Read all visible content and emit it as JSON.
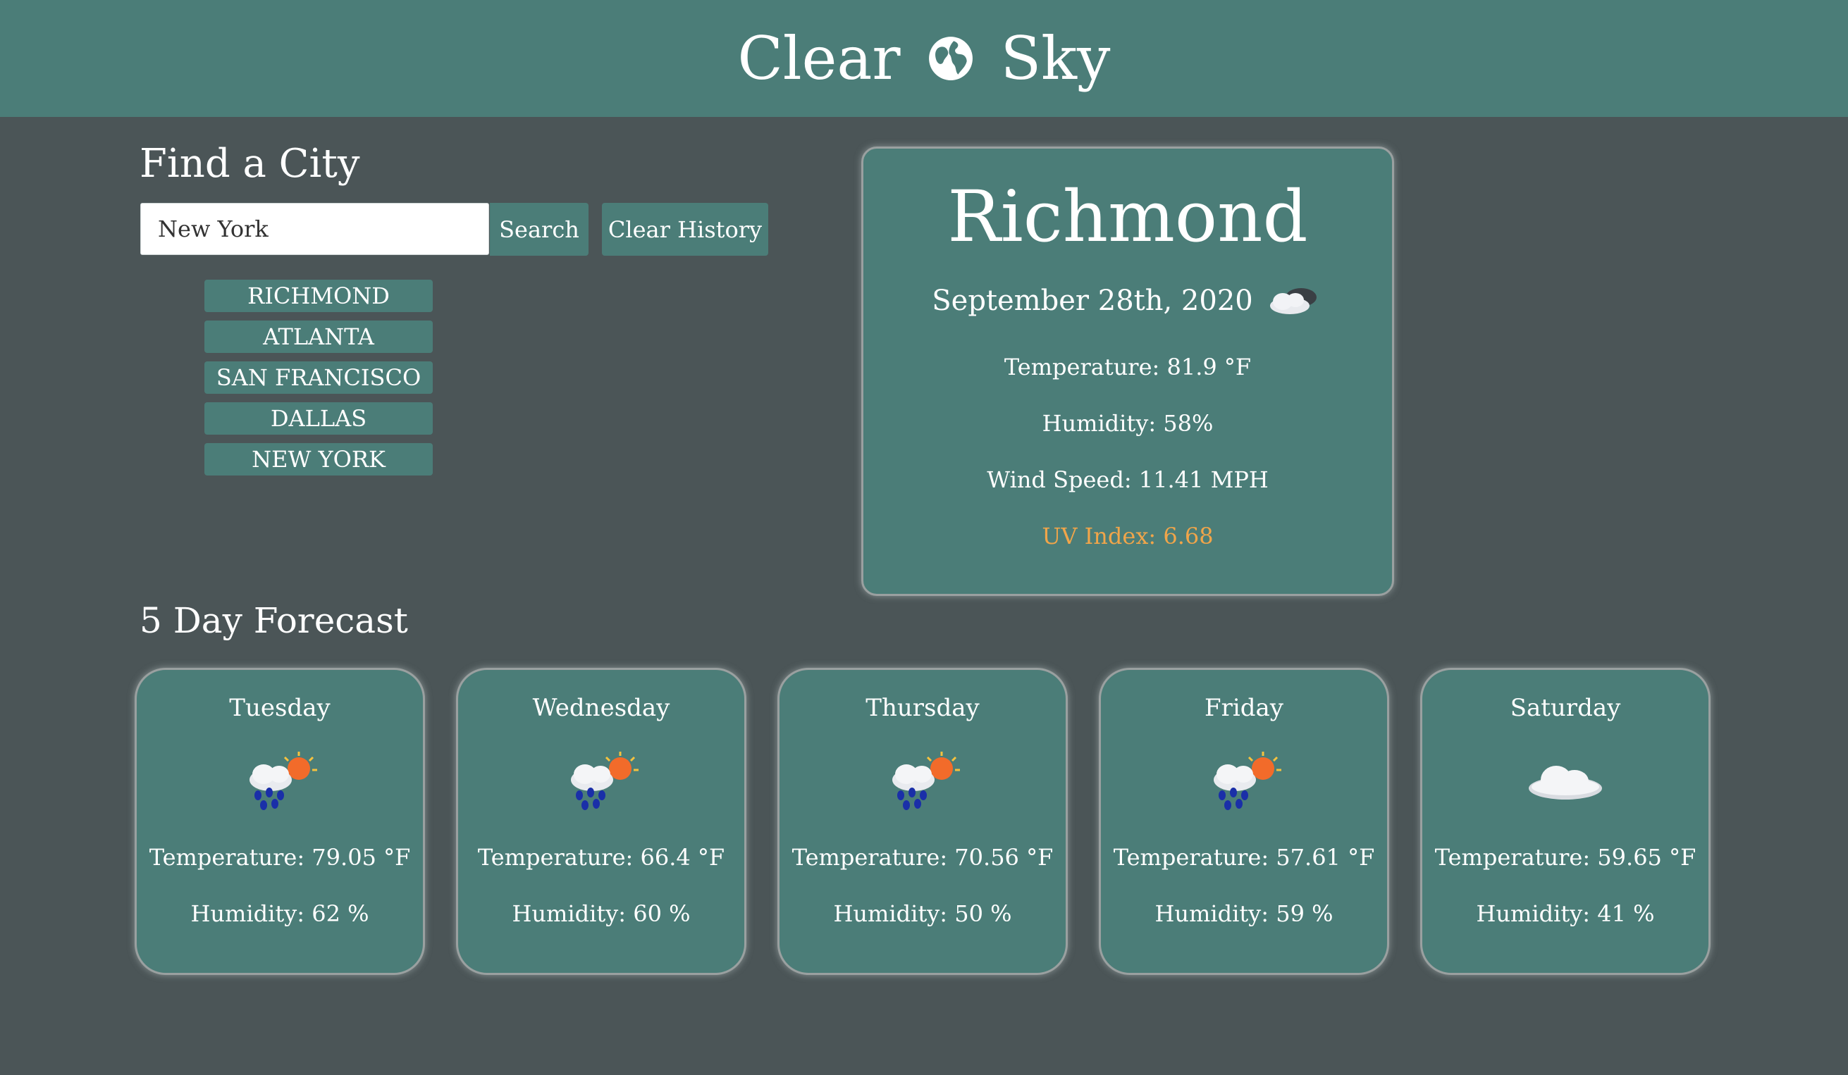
{
  "header": {
    "title_left": "Clear",
    "title_right": "Sky",
    "icon": "globe-icon"
  },
  "search": {
    "heading": "Find a City",
    "input_value": "New York",
    "search_label": "Search",
    "clear_label": "Clear History"
  },
  "history": [
    "Richmond",
    "Atlanta",
    "San Francisco",
    "Dallas",
    "New York"
  ],
  "current": {
    "city": "Richmond",
    "date": "September 28th, 2020",
    "icon": "partly-cloudy-icon",
    "temperature": "Temperature: 81.9 °F",
    "humidity": "Humidity: 58%",
    "wind": "Wind Speed: 11.41 MPH",
    "uv": "UV Index: 6.68",
    "uv_color": "#f0a54a"
  },
  "forecast": {
    "heading": "5 Day Forecast",
    "days": [
      {
        "day": "Tuesday",
        "icon": "rain-sun-icon",
        "temperature": "Temperature: 79.05 °F",
        "humidity": "Humidity: 62 %"
      },
      {
        "day": "Wednesday",
        "icon": "rain-sun-icon",
        "temperature": "Temperature: 66.4 °F",
        "humidity": "Humidity: 60 %"
      },
      {
        "day": "Thursday",
        "icon": "rain-sun-icon",
        "temperature": "Temperature: 70.56 °F",
        "humidity": "Humidity: 50 %"
      },
      {
        "day": "Friday",
        "icon": "rain-sun-icon",
        "temperature": "Temperature: 57.61 °F",
        "humidity": "Humidity: 59 %"
      },
      {
        "day": "Saturday",
        "icon": "cloud-icon",
        "temperature": "Temperature: 59.65 °F",
        "humidity": "Humidity: 41 %"
      }
    ]
  },
  "colors": {
    "background": "#4b5557",
    "accent": "#4b7d78",
    "uv_warning": "#f0a54a"
  }
}
